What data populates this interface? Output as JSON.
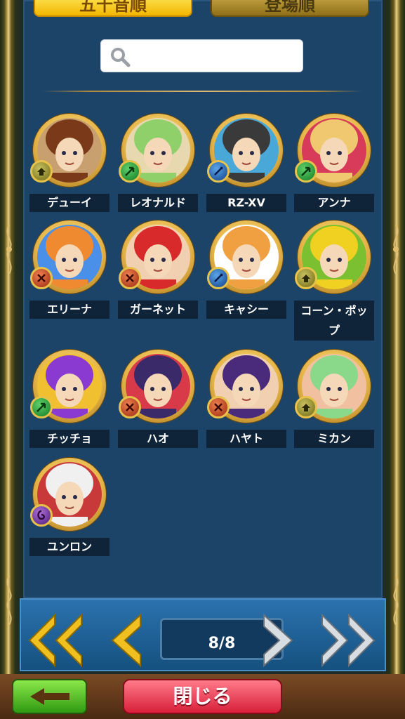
{
  "tabs": [
    {
      "label": "五十音順",
      "active": true
    },
    {
      "label": "登場順",
      "active": false
    }
  ],
  "search": {
    "placeholder": "",
    "value": ""
  },
  "characters": [
    {
      "name": "デューイ",
      "element": "earth",
      "colors": [
        "#7a3a1a",
        "#c8a070"
      ]
    },
    {
      "name": "レオナルド",
      "element": "wind",
      "colors": [
        "#8fd06a",
        "#e8d8b0"
      ]
    },
    {
      "name": "RZ-XV",
      "element": "water",
      "colors": [
        "#3a3a3a",
        "#4aa8d8"
      ]
    },
    {
      "name": "アンナ",
      "element": "wind",
      "colors": [
        "#f0c870",
        "#d83a5a"
      ]
    },
    {
      "name": "エリーナ",
      "element": "fire",
      "colors": [
        "#f08a30",
        "#4a90e8"
      ]
    },
    {
      "name": "ガーネット",
      "element": "fire",
      "colors": [
        "#d82a2a",
        "#f0d0b0"
      ]
    },
    {
      "name": "キャシー",
      "element": "water",
      "colors": [
        "#f0a040",
        "#ffffff"
      ]
    },
    {
      "name": "コーン・ポップ",
      "element": "earth",
      "colors": [
        "#f0d020",
        "#7ac030"
      ]
    },
    {
      "name": "チッチョ",
      "element": "wind",
      "colors": [
        "#8a3ad0",
        "#f0c030"
      ]
    },
    {
      "name": "ハオ",
      "element": "fire",
      "colors": [
        "#3a2a6a",
        "#d83a4a"
      ]
    },
    {
      "name": "ハヤト",
      "element": "fire",
      "colors": [
        "#4a2a7a",
        "#f0d0b0"
      ]
    },
    {
      "name": "ミカン",
      "element": "earth",
      "colors": [
        "#8ad88a",
        "#f0c0a0"
      ]
    },
    {
      "name": "ユンロン",
      "element": "dark",
      "colors": [
        "#f0f0f0",
        "#c83a3a"
      ]
    }
  ],
  "pager": {
    "label": "8/8",
    "current": 8,
    "total": 8
  },
  "buttons": {
    "close_label": "閉じる"
  },
  "colors": {
    "panel": "#1c4468",
    "namebar": "#0f2438",
    "close": "#d8203a",
    "back": "#2f9a12"
  }
}
